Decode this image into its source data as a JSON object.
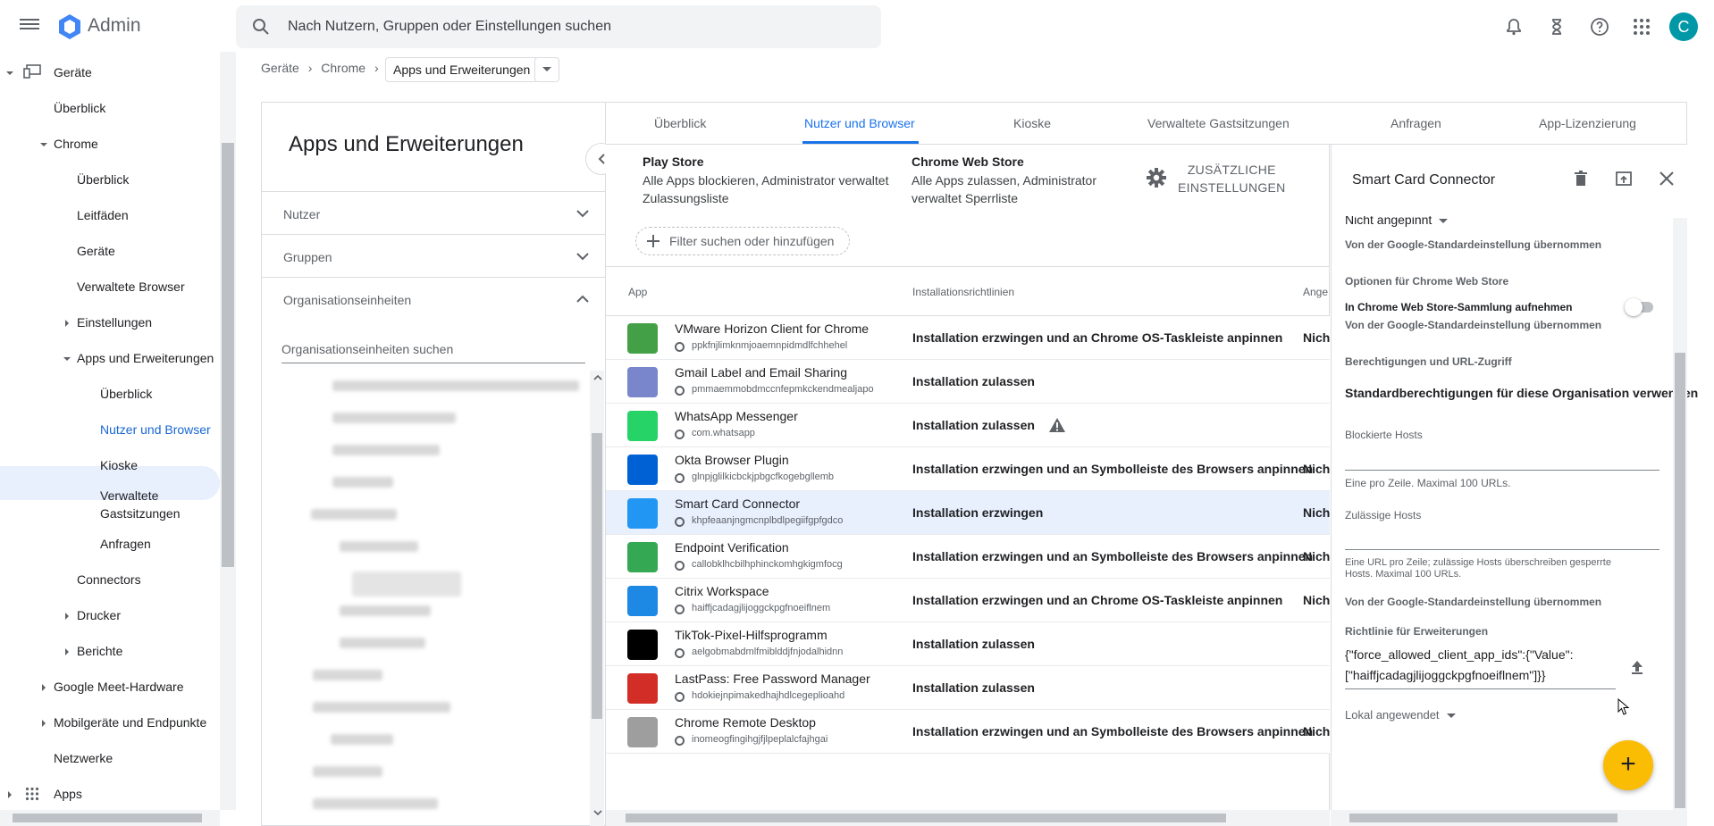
{
  "app": {
    "title": "Admin",
    "avatar_letter": "C",
    "accent": "#1a73e8"
  },
  "search": {
    "placeholder": "Nach Nutzern, Gruppen oder Einstellungen suchen"
  },
  "sidebar": {
    "items": [
      {
        "label": "Geräte"
      },
      {
        "label": "Überblick"
      },
      {
        "label": "Chrome"
      },
      {
        "label": "Überblick"
      },
      {
        "label": "Leitfäden"
      },
      {
        "label": "Geräte"
      },
      {
        "label": "Verwaltete Browser"
      },
      {
        "label": "Einstellungen"
      },
      {
        "label": "Apps und Erweiterungen"
      },
      {
        "label": "Überblick"
      },
      {
        "label": "Nutzer und Browser"
      },
      {
        "label": "Kioske"
      },
      {
        "label": "Verwaltete"
      },
      {
        "label": "Gastsitzungen"
      },
      {
        "label": "Anfragen"
      },
      {
        "label": "Connectors"
      },
      {
        "label": "Drucker"
      },
      {
        "label": "Berichte"
      },
      {
        "label": "Google Meet-Hardware"
      },
      {
        "label": "Mobilgeräte und Endpunkte"
      },
      {
        "label": "Netzwerke"
      },
      {
        "label": "Apps"
      }
    ]
  },
  "breadcrumb": {
    "items": [
      "Geräte",
      "Chrome"
    ],
    "current": "Apps und Erweiterungen"
  },
  "left_card": {
    "heading": "Apps und Erweiterungen",
    "sections": [
      "Nutzer",
      "Gruppen",
      "Organisationseinheiten"
    ],
    "ou_search_placeholder": "Organisationseinheiten suchen"
  },
  "tabs": [
    "Überblick",
    "Nutzer und Browser",
    "Kioske",
    "Verwaltete Gastsitzungen",
    "Anfragen",
    "App-Lizenzierung"
  ],
  "active_tab": "Nutzer und Browser",
  "stores": {
    "play_title": "Play Store",
    "play_desc_1": "Alle Apps blockieren, Administrator verwaltet",
    "play_desc_2": "Zulassungsliste",
    "web_title": "Chrome Web Store",
    "web_desc_1": "Alle Apps zulassen, Administrator",
    "web_desc_2": "verwaltet Sperrliste",
    "extra_1": "ZUSÄTZLICHE",
    "extra_2": "EINSTELLUNGEN"
  },
  "filter": {
    "label": "Filter suchen oder hinzufügen"
  },
  "table": {
    "headers": [
      "App",
      "Installationsrichtlinien",
      "Ange"
    ],
    "rows": [
      {
        "name": "VMware Horizon Client for Chrome",
        "id": "ppkfnjlimknmjoaemnpidmdlfchhehel",
        "policy": "Installation erzwingen und an Chrome OS-Taskleiste anpinnen",
        "extra": "Nicht",
        "icon_color": "#43a047"
      },
      {
        "name": "Gmail Label and Email Sharing",
        "id": "pmmaemmobdmccnfepmkckendmealjapo",
        "policy": "Installation zulassen",
        "extra": "",
        "icon_color": "#7986cb"
      },
      {
        "name": "WhatsApp Messenger",
        "id": "com.whatsapp",
        "policy": "Installation zulassen",
        "extra": "",
        "icon_color": "#25d366",
        "warning": true
      },
      {
        "name": "Okta Browser Plugin",
        "id": "glnpjglilkicbckjpbgcfkogebgllemb",
        "policy": "Installation erzwingen und an Symbolleiste des Browsers anpinnen",
        "extra": "Nicht",
        "icon_color": "#0061d5"
      },
      {
        "name": "Smart Card Connector",
        "id": "khpfeaanjngmcnplbdlpegiifgpfgdco",
        "policy": "Installation erzwingen",
        "extra": "Nicht",
        "icon_color": "#2196f3",
        "selected": true
      },
      {
        "name": "Endpoint Verification",
        "id": "callobklhcbilhphinckomhgkigmfocg",
        "policy": "Installation erzwingen und an Symbolleiste des Browsers anpinnen",
        "extra": "Nicht",
        "icon_color": "#34a853"
      },
      {
        "name": "Citrix Workspace",
        "id": "haiffjcadagjlijoggckpgfnoeiflnem",
        "policy": "Installation erzwingen und an Chrome OS-Taskleiste anpinnen",
        "extra": "Nicht",
        "icon_color": "#1e88e5"
      },
      {
        "name": "TikTok-Pixel-Hilfsprogramm",
        "id": "aelgobmabdmlfmiblddjfnjodalhidnn",
        "policy": "Installation zulassen",
        "extra": "",
        "icon_color": "#000000"
      },
      {
        "name": "LastPass: Free Password Manager",
        "id": "hdokiejnpimakedhajhdlcegeplioahd",
        "policy": "Installation zulassen",
        "extra": "",
        "icon_color": "#d32d27"
      },
      {
        "name": "Chrome Remote Desktop",
        "id": "inomeogfingihgjfjlpeplalcfajhgai",
        "policy": "Installation erzwingen und an Symbolleiste des Browsers anpinnen",
        "extra": "Nicht",
        "icon_color": "#9e9e9e"
      }
    ]
  },
  "panel": {
    "title": "Smart Card Connector",
    "pin_value": "Nicht angepinnt",
    "inherited_1": "Von der Google-Standardeinstellung übernommen",
    "webstore_heading": "Optionen für Chrome Web Store",
    "webstore_collection": "In Chrome Web Store-Sammlung aufnehmen",
    "webstore_toggle_on": false,
    "inherited_2": "Von der Google-Standardeinstellung übernommen",
    "perm_heading": "Berechtigungen und URL-Zugriff",
    "perm_value": "Standardberechtigungen für diese Organisation verwenden",
    "blocked_label": "Blockierte Hosts",
    "blocked_help": "Eine pro Zeile. Maximal 100 URLs.",
    "allowed_label": "Zulässige Hosts",
    "allowed_help_1": "Eine URL pro Zeile; zulässige Hosts überschreiben gesperrte",
    "allowed_help_2": "Hosts. Maximal 100 URLs.",
    "inherited_3": "Von der Google-Standardeinstellung übernommen",
    "policy_label": "Richtlinie für Erweiterungen",
    "policy_line_1": "{\"force_allowed_client_app_ids\":{\"Value\":",
    "policy_line_2": "[\"haiffjcadagjlijoggckpgfnoeiflnem\"]}}",
    "applied": "Lokal angewendet"
  },
  "fab_label": "+"
}
